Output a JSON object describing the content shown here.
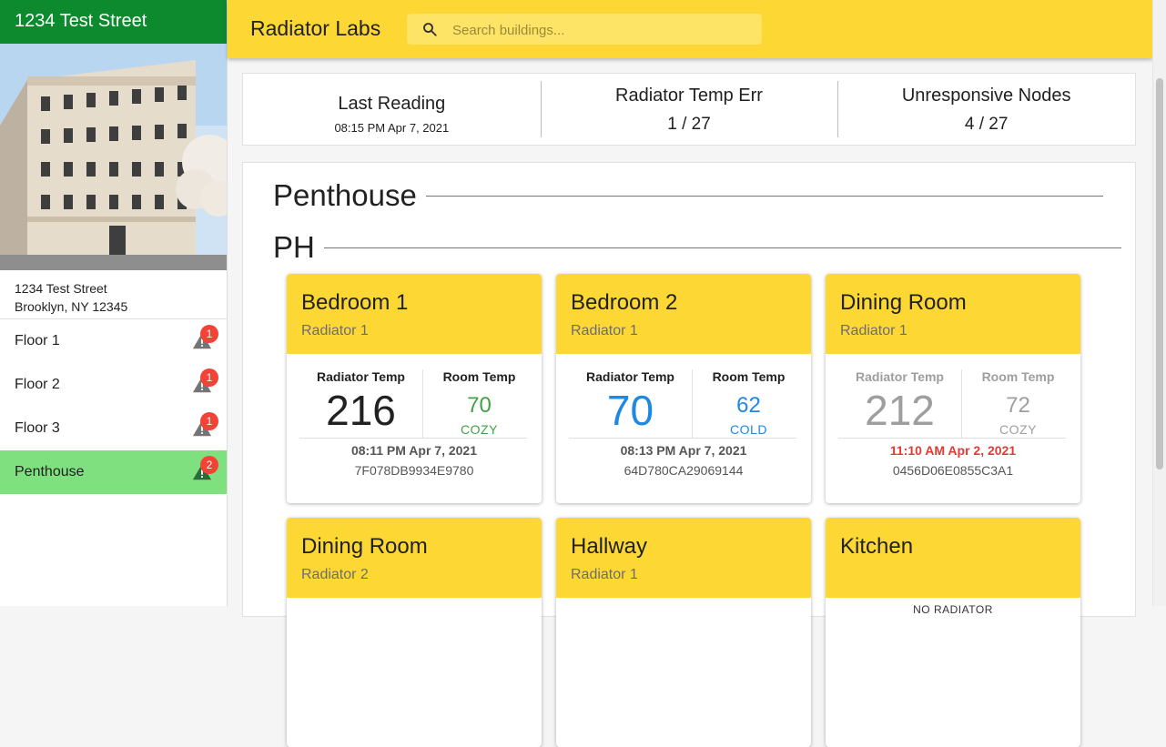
{
  "sidebar": {
    "title": "1234 Test Street",
    "address_line1": "1234 Test Street",
    "address_line2": "Brooklyn, NY 12345",
    "floors": [
      {
        "label": "Floor 1",
        "alerts": "1"
      },
      {
        "label": "Floor 2",
        "alerts": "1"
      },
      {
        "label": "Floor 3",
        "alerts": "1"
      },
      {
        "label": "Penthouse",
        "alerts": "2"
      }
    ]
  },
  "appbar": {
    "title": "Radiator Labs",
    "search_placeholder": "Search buildings..."
  },
  "stats": {
    "last_reading_title": "Last Reading",
    "last_reading_value": "08:15 PM Apr 7, 2021",
    "temp_err_title": "Radiator Temp Err",
    "temp_err_value": "1 / 27",
    "unresponsive_title": "Unresponsive Nodes",
    "unresponsive_value": "4 / 27"
  },
  "floor_title": "Penthouse",
  "unit_title": "PH",
  "card_labels": {
    "radiator_temp": "Radiator Temp",
    "room_temp": "Room Temp"
  },
  "cards": [
    {
      "room": "Bedroom 1",
      "radiator": "Radiator 1",
      "radiator_temp": "216",
      "room_temp": "70",
      "status": "COZY",
      "time": "08:11 PM Apr 7, 2021",
      "node": "7F078DB9934E9780"
    },
    {
      "room": "Bedroom 2",
      "radiator": "Radiator 1",
      "radiator_temp": "70",
      "room_temp": "62",
      "status": "COLD",
      "time": "08:13 PM Apr 7, 2021",
      "node": "64D780CA29069144"
    },
    {
      "room": "Dining Room",
      "radiator": "Radiator 1",
      "radiator_temp": "212",
      "room_temp": "72",
      "status": "COZY",
      "time": "11:10 AM Apr 2, 2021",
      "node": "0456D06E0855C3A1"
    },
    {
      "room": "Dining Room",
      "radiator": "Radiator 2"
    },
    {
      "room": "Hallway",
      "radiator": "Radiator 1"
    },
    {
      "room": "Kitchen",
      "no_radiator": "NO RADIATOR"
    }
  ],
  "colors": {
    "sidebar_header": "#0d8a2d",
    "active_floor": "#7fe07f",
    "appbar": "#fdd835",
    "alert_badge": "#f44336",
    "cozy": "#43a047",
    "cold": "#1e88e5",
    "stale_time": "#e53935"
  }
}
